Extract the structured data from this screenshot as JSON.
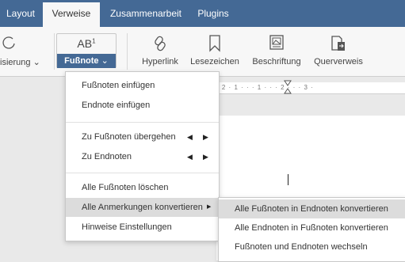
{
  "tabs": [
    {
      "label": "Layout"
    },
    {
      "label": "Verweise"
    },
    {
      "label": "Zusammenarbeit"
    },
    {
      "label": "Plugins"
    }
  ],
  "toolbar": {
    "partial_label": "isierung",
    "footnote_label": "Fußnote",
    "footnote_icon_text": "AB",
    "footnote_icon_sup": "1",
    "hyperlink": "Hyperlink",
    "bookmark": "Lesezeichen",
    "caption": "Beschriftung",
    "crossref": "Querverweis"
  },
  "ruler_text": "· 2 · 1 · · · 1 · · · 2 · · · 3 ·",
  "menu": {
    "items": [
      {
        "label": "Fußnoten einfügen"
      },
      {
        "label": "Endnote einfügen"
      },
      {
        "label": "Zu Fußnoten übergehen"
      },
      {
        "label": "Zu Endnoten"
      },
      {
        "label": "Alle Fußnoten löschen"
      },
      {
        "label": "Alle Anmerkungen konvertieren"
      },
      {
        "label": "Hinweise Einstellungen"
      }
    ]
  },
  "submenu": {
    "items": [
      {
        "label": "Alle Fußnoten in Endnoten konvertieren"
      },
      {
        "label": "Alle Endnoten in Fußnoten konvertieren"
      },
      {
        "label": "Fußnoten und Endnoten wechseln"
      }
    ]
  },
  "colors": {
    "accent": "#446995",
    "highlight": "#dcdcdc"
  }
}
